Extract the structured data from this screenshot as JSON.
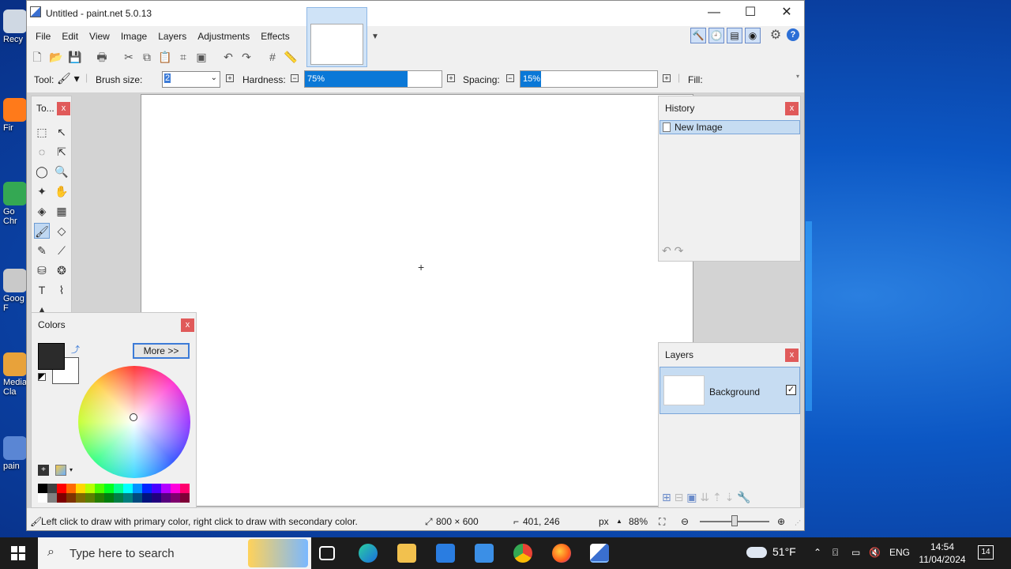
{
  "desktop": {
    "icons": [
      {
        "label": "Recy",
        "color": "#cfd8e3"
      },
      {
        "label": "Fir",
        "color": "#ff7a1a"
      },
      {
        "label": "Go Chr",
        "color": "#34a853"
      },
      {
        "label": "Goog F",
        "color": "#c9c9c9"
      },
      {
        "label": "Media Cla",
        "color": "#e8a23a"
      },
      {
        "label": "pain",
        "color": "#5a86d4"
      }
    ]
  },
  "window": {
    "title": "Untitled - paint.net 5.0.13",
    "min_glyph": "—",
    "max_glyph": "☐",
    "close_glyph": "✕"
  },
  "menu": [
    "File",
    "Edit",
    "View",
    "Image",
    "Layers",
    "Adjustments",
    "Effects"
  ],
  "toolbar": {
    "icons": [
      "new-icon",
      "open-icon",
      "save-icon",
      "print-icon",
      "cut-icon",
      "copy-icon",
      "paste-icon",
      "crop-icon",
      "deselect-icon",
      "undo-icon",
      "redo-icon",
      "grid-icon",
      "ruler-icon"
    ],
    "glyphs": [
      "🗋",
      "📂",
      "💾",
      "🖶",
      "✂",
      "⧉",
      "📋",
      "⌗",
      "▣",
      "↶",
      "↷",
      "#",
      "📏"
    ]
  },
  "right_icons": {
    "glyphs": [
      "🔨",
      "🕘",
      "▤",
      "◉",
      "⚙",
      "?"
    ]
  },
  "options": {
    "tool_label": "Tool:",
    "brush_size_label": "Brush size:",
    "brush_size_value": "2",
    "hardness_label": "Hardness:",
    "hardness_value": "75%",
    "hardness_fraction": 0.75,
    "spacing_label": "Spacing:",
    "spacing_value": "15%",
    "spacing_fraction": 0.15,
    "fill_label": "Fill:"
  },
  "tools_panel": {
    "title": "To...",
    "close": "x",
    "tools": [
      {
        "name": "rectangle-select-icon",
        "g": "⬚"
      },
      {
        "name": "move-selected-icon",
        "g": "↖"
      },
      {
        "name": "lasso-select-icon",
        "g": "◌"
      },
      {
        "name": "move-selection-icon",
        "g": "⇱"
      },
      {
        "name": "ellipse-select-icon",
        "g": "◯"
      },
      {
        "name": "zoom-icon",
        "g": "🔍"
      },
      {
        "name": "magic-wand-icon",
        "g": "✦"
      },
      {
        "name": "pan-icon",
        "g": "✋"
      },
      {
        "name": "paint-bucket-icon",
        "g": "◈"
      },
      {
        "name": "gradient-icon",
        "g": "▦"
      },
      {
        "name": "paintbrush-icon",
        "g": "🖌"
      },
      {
        "name": "eraser-icon",
        "g": "◇"
      },
      {
        "name": "pencil-icon",
        "g": "✎"
      },
      {
        "name": "color-picker-icon",
        "g": "⟋"
      },
      {
        "name": "clone-stamp-icon",
        "g": "⛁"
      },
      {
        "name": "recolor-icon",
        "g": "❂"
      },
      {
        "name": "text-icon",
        "g": "T"
      },
      {
        "name": "line-curve-icon",
        "g": "⌇"
      },
      {
        "name": "shapes-icon",
        "g": "▲"
      }
    ]
  },
  "colors_panel": {
    "title": "Colors",
    "close": "x",
    "more_label": "More >>",
    "primary_color": "#2b2b2b",
    "secondary_color": "#ffffff",
    "palette": [
      "#000000",
      "#404040",
      "#ff0000",
      "#ff6a00",
      "#ffd800",
      "#b6ff00",
      "#4cff00",
      "#00ff21",
      "#00ff90",
      "#00ffff",
      "#0094ff",
      "#0026ff",
      "#4800ff",
      "#b200ff",
      "#ff00dc",
      "#ff006e",
      "#ffffff",
      "#808080",
      "#7f0000",
      "#7f3300",
      "#7f6a00",
      "#5b7f00",
      "#267f00",
      "#007f0e",
      "#007f46",
      "#007f7f",
      "#004a7f",
      "#00137f",
      "#21007f",
      "#57007f",
      "#7f006e",
      "#7f0037"
    ]
  },
  "history_panel": {
    "title": "History",
    "close": "x",
    "items": [
      "New Image"
    ]
  },
  "layers_panel": {
    "title": "Layers",
    "close": "x",
    "layers": [
      {
        "name": "Background",
        "visible_glyph": "✓"
      }
    ]
  },
  "status": {
    "hint": "Left click to draw with primary color, right click to draw with secondary color.",
    "image_size": "800 × 600",
    "cursor_pos": "401, 246",
    "units": "px",
    "zoom": "88%"
  },
  "taskbar": {
    "search_placeholder": "Type here to search",
    "weather": "51°F",
    "lang": "ENG",
    "time": "14:54",
    "date": "11/04/2024",
    "notifications": "14"
  }
}
